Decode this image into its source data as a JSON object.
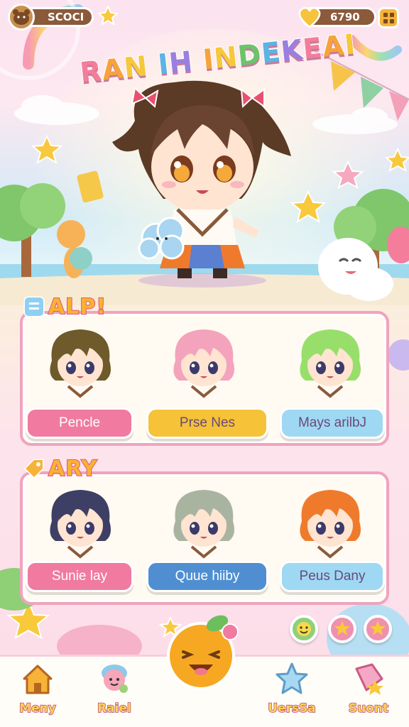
{
  "hud": {
    "coins": "SCOCI",
    "gems": "6790",
    "colors": {
      "pill": "#8a5a3b",
      "gold": "#f5b33a"
    }
  },
  "title": {
    "text": "RAN IH INDEKEAI",
    "letter_colors": [
      "#f47d9b",
      "#f7a23b",
      "#f6c83a",
      "#6cc36a",
      "#5bb4e4",
      "#9a7fe0",
      "#f47d9b",
      "#f7a23b",
      "#f6c83a",
      "#6cc36a",
      "#5bb4e4",
      "#9a7fe0",
      "#f47d9b",
      "#f7a23b",
      "#f6c83a"
    ]
  },
  "section1": {
    "heading": "ALP!",
    "characters": [
      {
        "name": "Pencle",
        "hair": "#6e5a2a",
        "btn_color": "#f07aa0"
      },
      {
        "name": "Prse Nes",
        "hair": "#f4a3bc",
        "btn_color": "#f5c238"
      },
      {
        "name": "Mays arilbJ",
        "hair": "#97df6a",
        "btn_color": "#9fd8f2"
      }
    ]
  },
  "section2": {
    "heading": "ARY",
    "characters": [
      {
        "name": "Sunie lay",
        "hair": "#3d3f64",
        "btn_color": "#f07aa0"
      },
      {
        "name": "Quue hiiby",
        "hair": "#a9b4a0",
        "btn_color": "#4f8fd1"
      },
      {
        "name": "Peus Dany",
        "hair": "#ef7a2c",
        "btn_color": "#9fd8f2"
      }
    ]
  },
  "nav": {
    "items": [
      {
        "label": "Meny",
        "icon": "house-icon"
      },
      {
        "label": "Raiel",
        "icon": "character-icon"
      },
      {
        "label": "",
        "icon": "orange-mascot-icon"
      },
      {
        "label": "UersSa",
        "icon": "star-icon"
      },
      {
        "label": "Suont",
        "icon": "shop-icon"
      }
    ]
  }
}
